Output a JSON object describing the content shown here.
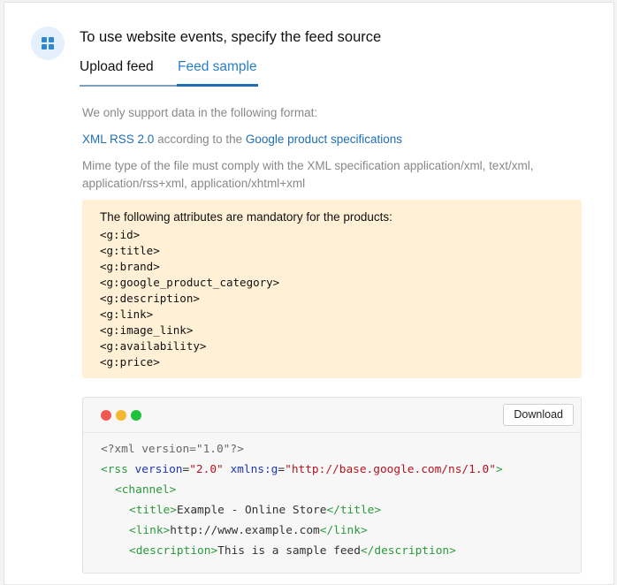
{
  "header": {
    "title": "To use website events, specify the feed source",
    "icon": "apps-grid-icon",
    "icon_color": "#2f86d4"
  },
  "tabs": [
    {
      "label": "Upload feed",
      "active": false
    },
    {
      "label": "Feed sample",
      "active": true
    }
  ],
  "info": {
    "format_intro": "We only support data in the following format:",
    "format_link": "XML RSS 2.0",
    "according_text": "according to the",
    "spec_link": "Google product specifications",
    "mime_text": "Mime type of the file must comply with the XML specification application/xml, text/xml, application/rss+xml, application/xhtml+xml"
  },
  "mandatory": {
    "title": "The following attributes are mandatory for the products:",
    "items": [
      "<g:id>",
      "<g:title>",
      "<g:brand>",
      "<g:google_product_category>",
      "<g:description>",
      "<g:link>",
      "<g:image_link>",
      "<g:availability>",
      "<g:price>"
    ]
  },
  "code_sample": {
    "download_label": "Download",
    "xml_decl": "<?xml version=\"1.0\"?>",
    "rss_open": "<rss",
    "rss_version_attr": "version",
    "rss_version_val": "\"2.0\"",
    "rss_ns_attr": "xmlns:g",
    "rss_ns_val": "\"http://base.google.com/ns/1.0\"",
    "rss_close": ">",
    "channel_open": "<channel>",
    "title_open": "<title>",
    "title_text": "Example - Online Store",
    "title_close": "</title>",
    "link_open": "<link>",
    "link_text": "http://www.example.com",
    "link_close": "</link>",
    "desc_open": "<description>",
    "desc_text": "This is a sample feed",
    "desc_close": "</description>"
  },
  "colors": {
    "accent": "#1f6fb5",
    "notice_bg": "#fff0d6",
    "code_tag": "#2a9a3c",
    "code_attr": "#1e36b0",
    "code_value": "#b3151f"
  }
}
